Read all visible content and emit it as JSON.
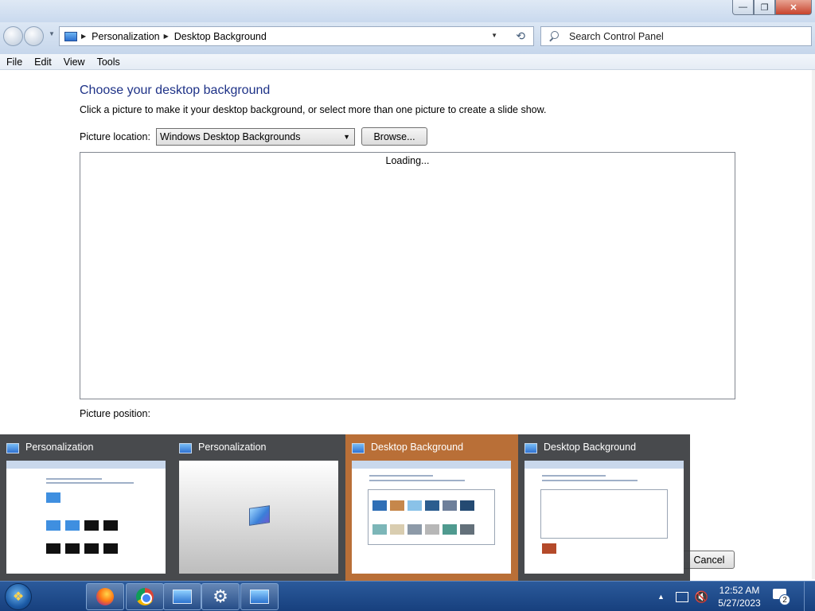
{
  "window": {
    "controls": {
      "minimize": "—",
      "maximize": "❐",
      "close": "✕"
    }
  },
  "nav": {
    "breadcrumbs": [
      "Personalization",
      "Desktop Background"
    ],
    "search_placeholder": "Search Control Panel",
    "refresh_glyph": "⟲"
  },
  "menu": [
    "File",
    "Edit",
    "View",
    "Tools"
  ],
  "content": {
    "heading": "Choose your desktop background",
    "subtitle": "Click a picture to make it your desktop background, or select more than one picture to create a slide show.",
    "picture_location_label": "Picture location:",
    "picture_location_value": "Windows Desktop Backgrounds",
    "browse_label": "Browse...",
    "gallery_status": "Loading...",
    "picture_position_label": "Picture position:",
    "cancel_label": "Cancel"
  },
  "thumbnails": [
    {
      "title": "Personalization",
      "active": false
    },
    {
      "title": "Personalization",
      "active": false
    },
    {
      "title": "Desktop Background",
      "active": true
    },
    {
      "title": "Desktop Background",
      "active": false
    }
  ],
  "taskbar": {
    "start_glyph": "❖",
    "gear_glyph": "⚙",
    "time": "12:52 AM",
    "date": "5/27/2023",
    "notification_count": "2"
  },
  "colors": {
    "heading": "#1e3287",
    "active_thumbnail": "#b96f37",
    "taskbar": "#1f4b8c"
  }
}
